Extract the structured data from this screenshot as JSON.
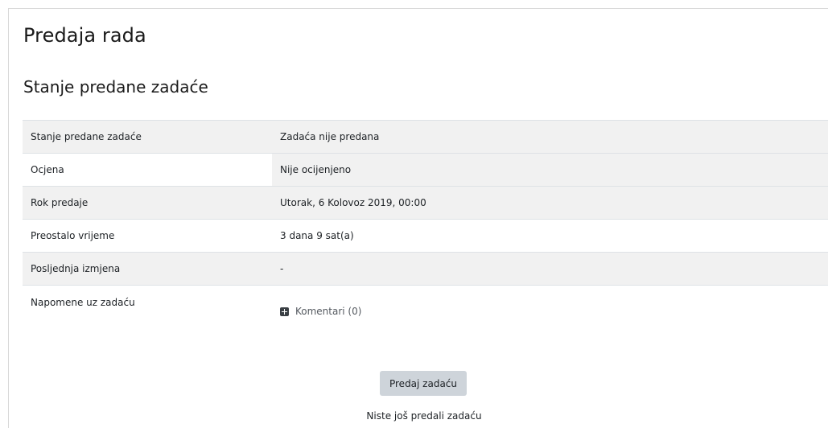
{
  "page": {
    "title": "Predaja rada",
    "section_title": "Stanje predane zadaće"
  },
  "status_table": {
    "rows": [
      {
        "label": "Stanje predane zadaće",
        "value": "Zadaća nije predana"
      },
      {
        "label": "Ocjena",
        "value": "Nije ocijenjeno"
      },
      {
        "label": "Rok predaje",
        "value": "Utorak, 6 Kolovoz 2019, 00:00"
      },
      {
        "label": "Preostalo vrijeme",
        "value": "3 dana 9 sat(a)"
      },
      {
        "label": "Posljednja izmjena",
        "value": "-"
      },
      {
        "label": "Napomene uz zadaću",
        "comments_link": "Komentari (0)"
      }
    ]
  },
  "actions": {
    "submit_label": "Predaj zadaću",
    "submit_note": "Niste još predali zadaću"
  },
  "icons": {
    "comments_toggle": "plus-square-icon"
  }
}
